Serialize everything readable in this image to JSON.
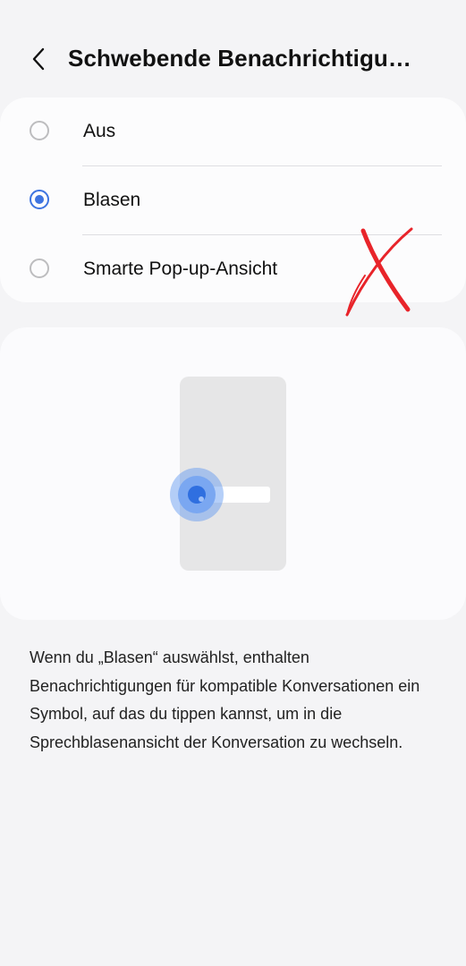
{
  "header": {
    "title": "Schwebende Benachrichtigu…",
    "back_icon": "chevron-left-icon"
  },
  "options": [
    {
      "label": "Aus",
      "selected": false
    },
    {
      "label": "Blasen",
      "selected": true
    },
    {
      "label": "Smarte Pop-up-Ansicht",
      "selected": false
    }
  ],
  "description": "Wenn du „Blasen“ auswählst, enthalten Benachrichtigungen für kompatible Konversationen ein Symbol, auf das du tippen kannst, um in die Sprechblasenansicht der Konversation zu wechseln.",
  "colors": {
    "accent": "#3e74e0",
    "background": "#f4f4f6",
    "card": "#fcfcfd",
    "annotation": "#e8242a"
  }
}
